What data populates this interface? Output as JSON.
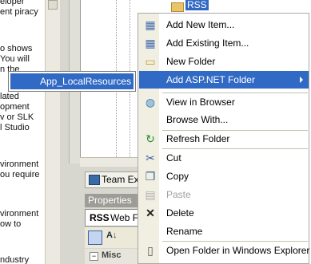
{
  "article_lines": [
    {
      "text": "eloper"
    },
    {
      "text": "ent piracy"
    },
    {
      "text": "o shows"
    },
    {
      "text": "You will"
    },
    {
      "text": "n the"
    },
    {
      "text": "lated"
    },
    {
      "text": "opment"
    },
    {
      "text": "v or SLK"
    },
    {
      "text": "l Studio"
    },
    {
      "text": "vironment"
    },
    {
      "text": "ou require"
    },
    {
      "text": "vironment"
    },
    {
      "text": "ow to"
    },
    {
      "text": "ndustry"
    }
  ],
  "tree_node": "RSS",
  "team_explorer_label": "Team Ex",
  "properties_title": "Properties",
  "properties_object": {
    "name": "RSS",
    "type": "Web F"
  },
  "misc_label": "Misc",
  "misc_toggle": "−",
  "context_menu": {
    "items": [
      {
        "label": "Add New Item...",
        "icon": "add-new-item-icon",
        "glyph": "▦"
      },
      {
        "label": "Add Existing Item...",
        "icon": "add-existing-item-icon",
        "glyph": "▦"
      },
      {
        "label": "New Folder",
        "icon": "new-folder-icon",
        "glyph": "▭"
      },
      {
        "label": "Add ASP.NET Folder",
        "icon": "",
        "glyph": ""
      },
      {
        "label": "View in Browser",
        "icon": "view-in-browser-icon",
        "glyph": "◍"
      },
      {
        "label": "Browse With...",
        "icon": "",
        "glyph": ""
      },
      {
        "label": "Refresh Folder",
        "icon": "refresh-icon",
        "glyph": "↻"
      },
      {
        "label": "Cut",
        "icon": "cut-icon",
        "glyph": "✂"
      },
      {
        "label": "Copy",
        "icon": "copy-icon",
        "glyph": "❐"
      },
      {
        "label": "Paste",
        "icon": "paste-icon",
        "glyph": "▤"
      },
      {
        "label": "Delete",
        "icon": "delete-icon",
        "glyph": "✕"
      },
      {
        "label": "Rename",
        "icon": "",
        "glyph": ""
      },
      {
        "label": "Open Folder in Windows Explorer",
        "icon": "open-folder-icon",
        "glyph": "▯"
      }
    ]
  },
  "submenu": {
    "item": "App_LocalResources"
  },
  "colors": {
    "selection": "#316ac5",
    "menu_gutter": "#f1efe2"
  }
}
